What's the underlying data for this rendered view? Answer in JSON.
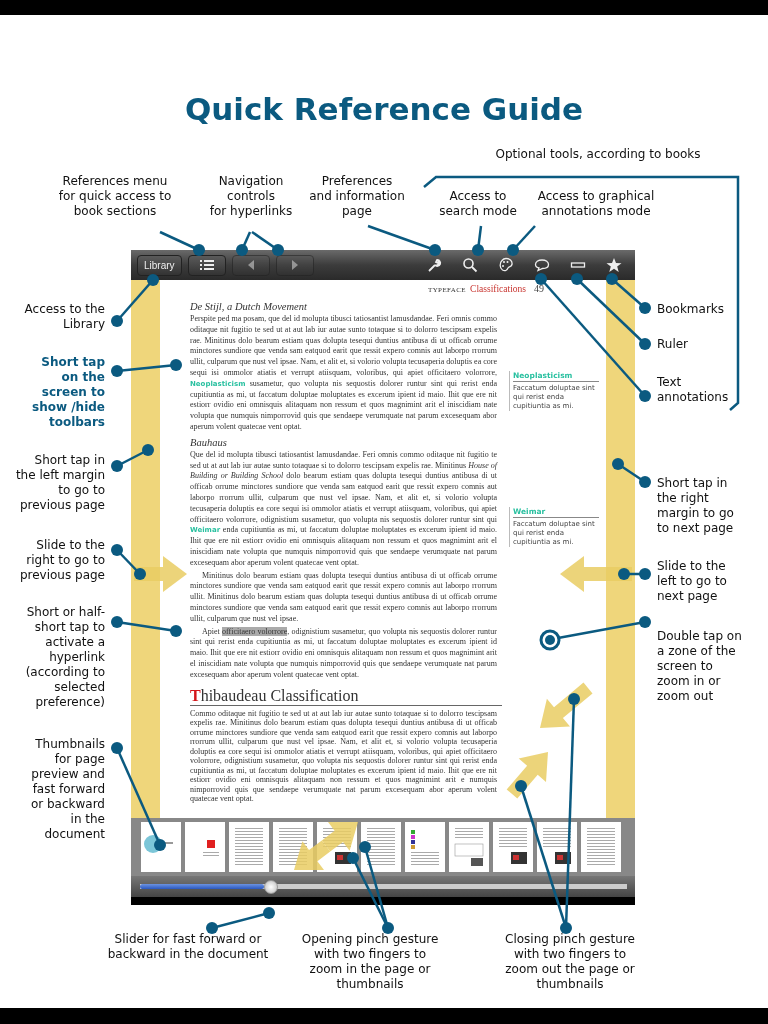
{
  "title": "Quick Reference Guide",
  "callouts": {
    "top": [
      "Optional tools, according to books",
      "References menu\nfor quick access to\nbook  sections",
      "Navigation\ncontrols\nfor hyperlinks",
      "Preferences\nand information\npage",
      "Access to\nsearch mode",
      "Access to graphical\nannotations mode"
    ],
    "left": [
      {
        "text": "Access to the\nLibrary",
        "emphasized": false
      },
      {
        "text": "Short tap\non the\nscreen to\nshow /hide\ntoolbars",
        "emphasized": true
      },
      {
        "text": "Short tap in\nthe left margin\nto go to\nprevious page",
        "emphasized": false
      },
      {
        "text": "Slide to the\nright to go to\nprevious page",
        "emphasized": false
      },
      {
        "text": "Short or half-\nshort tap to\nactivate a\nhyperlink\n(according to\nselected\npreference)",
        "emphasized": false
      },
      {
        "text": "Thumbnails\nfor page\npreview and\nfast forward\nor backward\nin the\ndocument",
        "emphasized": false
      }
    ],
    "right": [
      "Bookmarks",
      "Ruler",
      "Text\nannotations",
      "Short tap in\nthe right\nmargin to go\nto next page",
      "Slide to the\nleft to go to\nnext page",
      "Double tap on\na zone of the\nscreen to\nzoom in or\nzoom out"
    ],
    "bottom": [
      "Slider for fast forward or\nbackward in the document",
      "Opening pinch gesture\nwith two fingers to\nzoom in the page or\nthumbnails",
      "Closing pinch gesture\nwith two fingers to\nzoom out the page or\nthumbnails"
    ]
  },
  "toolbar": {
    "left": [
      {
        "kind": "label",
        "label": "Library",
        "disabled": false
      },
      {
        "kind": "list",
        "disabled": false
      },
      {
        "kind": "back",
        "disabled": true
      },
      {
        "kind": "forward",
        "disabled": true
      }
    ],
    "right": [
      {
        "kind": "wrench"
      },
      {
        "kind": "search"
      },
      {
        "kind": "palette"
      },
      {
        "kind": "comment"
      },
      {
        "kind": "ruler"
      },
      {
        "kind": "star"
      }
    ]
  },
  "book_page": {
    "header": {
      "section": "TYPEFACE",
      "chapter": "Classifications",
      "page": "49"
    },
    "sections": [
      {
        "heading": "De Stijl, a Dutch Movement",
        "paragraphs": [
          {
            "indent": false,
            "text": "Perspite ped ma posam, que del id molupta tibusci tatiosantist lamusdandae. Feri omnis commo oditaque nit fugitio te sed ut at aut lab iur autae sunto totaquae si to dolorro tescipsam expelis rae. Minitinus dolo bearum estiam quas dolupta tesequi duntius antibusa di ut officab orrume minctores sundiore que venda sam eatquod earit que ressit expero comnis aut laborpo rrorrum ullit, culparum que nust vel ipsae. Nam, et alit et, si volorio volupta tecusaperia doluptis ea core sequi isi ommolor atiatis et verrupt atiisquam, voloribus, qui apiet officitaero volorrore, **Neoplasticism** susametur, quo volupta nis sequostis dolorer runtur sint qui rerist enda cupitiuntia as mi, ut faccatum doluptae moluptates es excerum ipient id maio. Ihit que ere nit estiorr ovidio eni omnisquis alitaquam non ressum et quos magnimint arit el iniscidiam nate volupta que numquis nimporrovid quis que sendaepe verumquate nat parum excesequam abor aperum volent quatecae vent optat."
          }
        ],
        "note": {
          "term": "Neoplasticism",
          "text": "Faccatum doluptae sint qui rerist enda cupitiuntia as mi."
        }
      },
      {
        "heading": "Bauhaus",
        "paragraphs": [
          {
            "indent": false,
            "text": "Que del id molupta tibusci tatiosantist lamusdandae. Feri omnis commo oditaque nit fugitio te sed ut at aut lab iur autae sunto totaquae si to dolorro tescipsam expelis rae. Minitinus *House of Building or Building School* dolo bearum estiam quas dolupta tesequi duntius antibusa di ut officab orrume minctores sundiore que venda sam eatquod earit que ressit expero comnis aut laborpo rrorrum ullit, culparum que nust vel ipsae. Nam, et alit et, si volorio volupta tecusaperia doluptis ea core sequi isi ommolor atiatis et verrupt atiisquam, voloribus, qui apiet officitaero volorrore, odignistium susametur, quo volupta nis sequostis dolorer runtur sint qui **Weimar** enda cupitiuntia as mi, ut faccatum doluptae moluptates es excerum ipient id maio. Ihit que ere nit estiorr ovidio eni omnisquis alitaquam non ressum et quos magnimint arit el iniscidiam nate volupta que numquis nimporrovid quis que sendaepe verumquate nat parum excesequam abor aperum volent quatecae vent optat."
          }
        ],
        "note": {
          "term": "Weimar",
          "text": "Faccatum doluptae sint qui rerist enda cupitiuntia as mi."
        }
      },
      {
        "paragraphs": [
          {
            "indent": true,
            "text": "Minitinus dolo bearum estiam quas dolupta tesequi duntius antibusa di ut officab orrume minctores sundiore que venda sam eatquod earit que ressit expero comnis aut laborpo rrorrum ullit. Minitinus dolo bearum estiam quas dolupta tesequi duntius antibusa di ut officab orrume minctores sundiore que venda sam eatquod earit que ressit expero comnis aut laborpo rrorrum ullit, culparum que nust vel ipsae."
          },
          {
            "indent": true,
            "text": "Apiet ",
            "highlighted_text": "officitaero volorrore",
            "text_after": ", odignistium susametur, quo volupta nis sequostis dolorer runtur sint qui rerist enda cupitiuntia as mi, ut faccatum doluptae moluptates es excerum ipient id maio. Ihit que ere nit estiorr ovidio eni omnisquis alitaquam non ressum et quos magnimint arit el iniscidiam nate volupta que numquis nimporrovid quis que sendaepe verumquate nat parum excesequam abor aperum volent quatecae vent optat."
          }
        ]
      },
      {
        "title": {
          "initial": "T",
          "rest": "hibaudeau Classification"
        },
        "paragraphs": [
          {
            "indent": false,
            "text": "Commo oditaque nit fugitio te sed ut at aut lab iur autae sunto totaquae si to dolorro tescipsam expelis rae. Minitinus dolo bearum estiam quas dolupta tesequi duntius antibusa di ut officab orrume minctores sundiore que venda sam eatquod earit que ressit expero comnis aut laborpo rrorrum ullit, culparum que nust vel ipsae. Nam, et alit et, si volorio volupta tecusaperia doluptis ea core sequi isi ommolor atiatis et verrupt atiisquam, voloribus, qui apiet officitaero volorrore, odignistium susametur, quo volupta nis sequostis dolorer runtur sint qui rerist enda cupitiuntia as mi, ut faccatum doluptae moluptates es excerum ipient id maio. Ihit que ere nit estiorr ovidio eni omnisquis alitaquam non ressum et quos magnimint arit e numquis nimporrovid quis que sendaepe verumquate nat parum excesequam abor aperum volent quatecae vent optat."
          }
        ]
      }
    ]
  },
  "thumbnails": [
    {
      "kind": "cover"
    },
    {
      "kind": "title"
    },
    {
      "kind": "text"
    },
    {
      "kind": "text"
    },
    {
      "kind": "figure"
    },
    {
      "kind": "text"
    },
    {
      "kind": "list"
    },
    {
      "kind": "table"
    },
    {
      "kind": "figure"
    },
    {
      "kind": "figure"
    },
    {
      "kind": "text"
    }
  ],
  "slider": {
    "level": 0.27
  }
}
